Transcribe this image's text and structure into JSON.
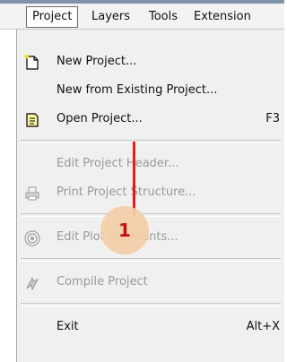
{
  "menubar": {
    "items": [
      {
        "label": "Project",
        "active": true
      },
      {
        "label": "Layers"
      },
      {
        "label": "Tools"
      },
      {
        "label": "Extension"
      }
    ]
  },
  "menu": {
    "new_project": {
      "label": "New Project...",
      "icon": "new-document-icon"
    },
    "new_from_existing": {
      "label": "New from Existing Project..."
    },
    "open_project": {
      "label": "Open Project...",
      "shortcut": "F3",
      "icon": "open-document-icon"
    },
    "edit_header": {
      "label": "Edit Project Header...",
      "disabled": true
    },
    "print_structure": {
      "label": "Print Project Structure...",
      "disabled": true,
      "icon": "printer-icon"
    },
    "edit_plot_segments": {
      "label": "Edit Plot Segments...",
      "disabled": true,
      "icon": "target-icon"
    },
    "compile_project": {
      "label": "Compile Project",
      "disabled": true,
      "icon": "compile-icon"
    },
    "exit": {
      "label": "Exit",
      "shortcut": "Alt+X"
    }
  },
  "annotation": {
    "number": "1",
    "color": "#e31b1b",
    "badge_color": "#f3cfa7"
  }
}
